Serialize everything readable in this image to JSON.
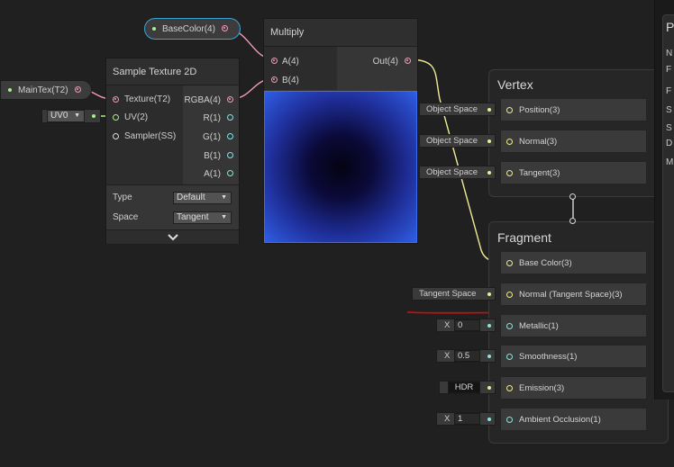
{
  "canvas": {
    "wire_colors": {
      "color4": "#f09abf",
      "vector3": "#f0eb95",
      "vector2": "#a8f08c",
      "float": "#86e5e0"
    }
  },
  "properties": {
    "base_color": {
      "label": "BaseColor(4)"
    },
    "main_tex": {
      "label": "MainTex(T2)"
    }
  },
  "uv_dropdown": {
    "value": "UV0"
  },
  "sample_texture_node": {
    "title": "Sample Texture 2D",
    "inputs": [
      "Texture(T2)",
      "UV(2)",
      "Sampler(SS)"
    ],
    "outputs": [
      "RGBA(4)",
      "R(1)",
      "G(1)",
      "B(1)",
      "A(1)"
    ],
    "settings": [
      {
        "label": "Type",
        "value": "Default"
      },
      {
        "label": "Space",
        "value": "Tangent"
      }
    ],
    "expand_icon": "chevron-down-icon"
  },
  "multiply_node": {
    "title": "Multiply",
    "inputs": [
      "A(4)",
      "B(4)"
    ],
    "output": "Out(4)",
    "preview_colors": {
      "edge": "#2f5ee4",
      "center": "#050312"
    }
  },
  "vertex_block": {
    "title": "Vertex",
    "slots": [
      {
        "label": "Position(3)",
        "input": "Object Space"
      },
      {
        "label": "Normal(3)",
        "input": "Object Space"
      },
      {
        "label": "Tangent(3)",
        "input": "Object Space"
      }
    ]
  },
  "fragment_block": {
    "title": "Fragment",
    "slots": [
      {
        "label": "Base Color(3)"
      },
      {
        "label": "Normal (Tangent Space)(3)",
        "input": "Tangent Space"
      },
      {
        "label": "Metallic(1)",
        "axis": "X",
        "value": "0"
      },
      {
        "label": "Smoothness(1)",
        "axis": "X",
        "value": "0.5"
      },
      {
        "label": "Emission(3)",
        "input": "HDR"
      },
      {
        "label": "Ambient Occlusion(1)",
        "axis": "X",
        "value": "1"
      }
    ]
  },
  "side_panel": {
    "header": "P",
    "letters": [
      "N",
      "F",
      "F",
      "S",
      "S",
      "D",
      "M"
    ]
  },
  "annotation": {
    "underline_color": "#c01010"
  }
}
